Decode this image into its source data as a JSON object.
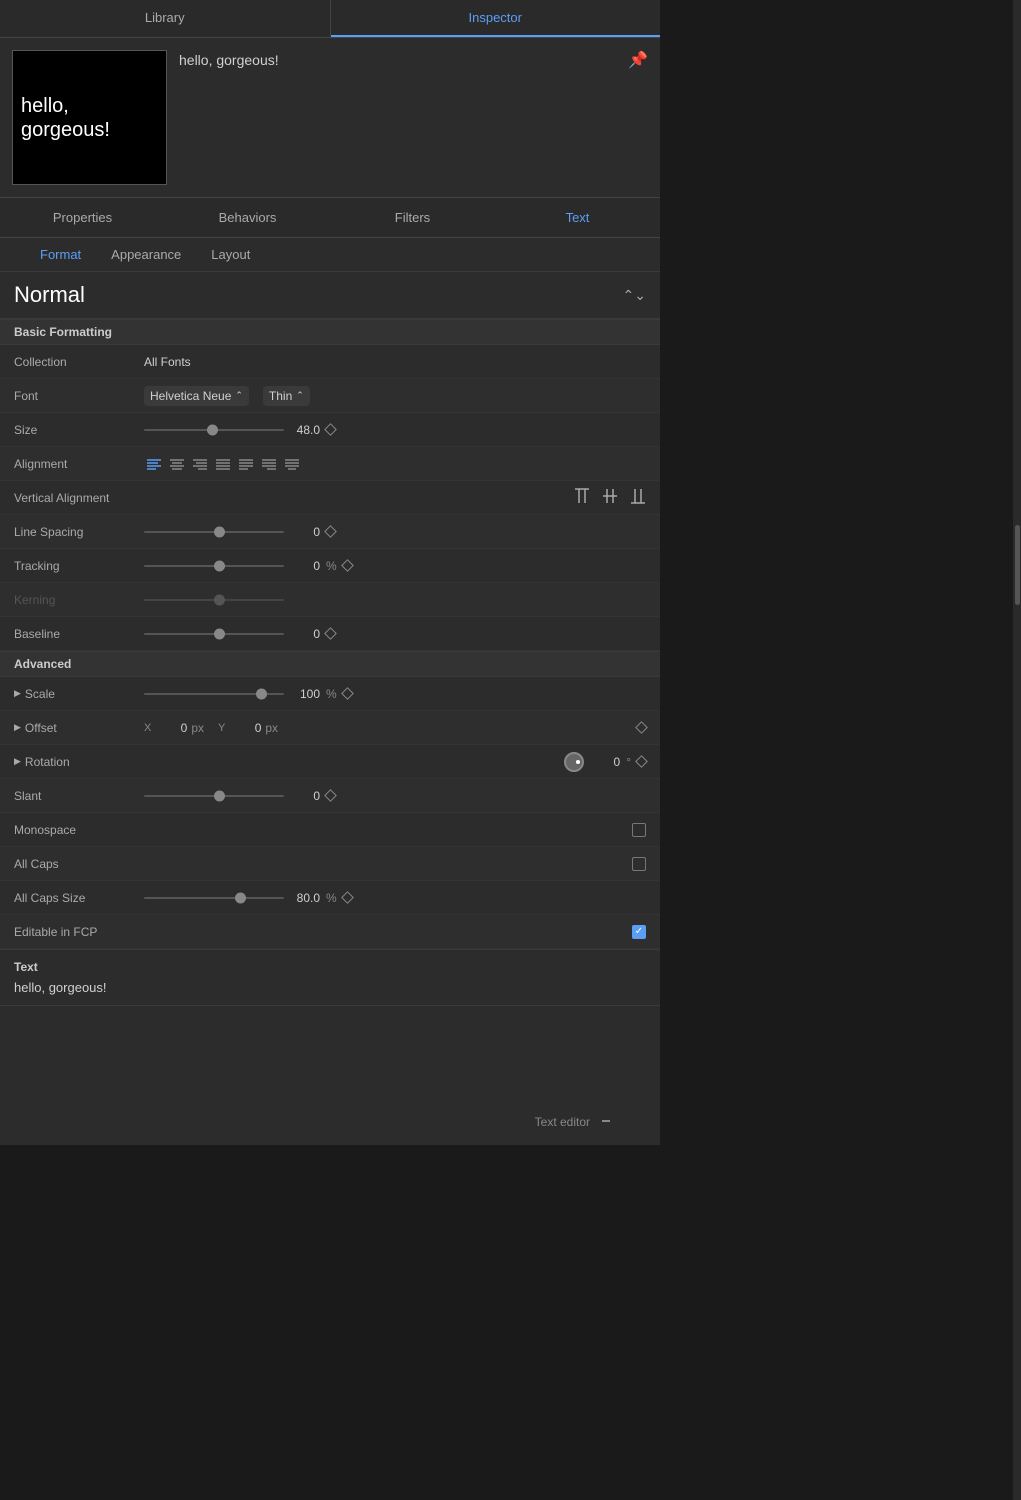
{
  "topTabs": [
    {
      "label": "Library",
      "active": false
    },
    {
      "label": "Inspector",
      "active": true
    }
  ],
  "preview": {
    "title": "hello, gorgeous!",
    "previewText": "hello, gorgeous!"
  },
  "inspectorTabs": [
    {
      "label": "Properties",
      "active": false
    },
    {
      "label": "Behaviors",
      "active": false
    },
    {
      "label": "Filters",
      "active": false
    },
    {
      "label": "Text",
      "active": true
    }
  ],
  "subTabs": [
    {
      "label": "Format",
      "active": true
    },
    {
      "label": "Appearance",
      "active": false
    },
    {
      "label": "Layout",
      "active": false
    }
  ],
  "styleSelector": {
    "name": "Normal"
  },
  "sections": {
    "basicFormatting": {
      "label": "Basic Formatting",
      "fields": {
        "collection": {
          "label": "Collection",
          "value": "All Fonts"
        },
        "font": {
          "label": "Font",
          "fontName": "Helvetica Neue",
          "fontWeight": "Thin"
        },
        "size": {
          "label": "Size",
          "value": "48.0",
          "sliderPos": "45%"
        },
        "alignment": {
          "label": "Alignment"
        },
        "verticalAlignment": {
          "label": "Vertical Alignment"
        },
        "lineSpacing": {
          "label": "Line Spacing",
          "value": "0",
          "sliderPos": "50%"
        },
        "tracking": {
          "label": "Tracking",
          "value": "0",
          "unit": "%",
          "sliderPos": "50%"
        },
        "kerning": {
          "label": "Kerning",
          "disabled": true,
          "sliderPos": "50%"
        },
        "baseline": {
          "label": "Baseline",
          "value": "0",
          "sliderPos": "50%"
        }
      }
    },
    "advanced": {
      "label": "Advanced",
      "fields": {
        "scale": {
          "label": "Scale",
          "value": "100",
          "unit": "%",
          "sliderPos": "80%"
        },
        "offset": {
          "label": "Offset",
          "xValue": "0",
          "yValue": "0",
          "unit": "px"
        },
        "rotation": {
          "label": "Rotation",
          "value": "0",
          "unit": "°"
        },
        "slant": {
          "label": "Slant",
          "value": "0",
          "sliderPos": "50%"
        },
        "monospace": {
          "label": "Monospace",
          "checked": false
        },
        "allCaps": {
          "label": "All Caps",
          "checked": false
        },
        "allCapsSize": {
          "label": "All Caps Size",
          "value": "80.0",
          "unit": "%",
          "sliderPos": "65%"
        },
        "editableInFCP": {
          "label": "Editable in FCP",
          "checked": true
        }
      }
    }
  },
  "textPreview": {
    "label": "Text",
    "content": "hello, gorgeous!"
  },
  "textEditorLabel": "Text editor",
  "alignmentButtons": [
    {
      "type": "left",
      "active": true,
      "symbol": "≡"
    },
    {
      "type": "center",
      "active": false,
      "symbol": "≡"
    },
    {
      "type": "right",
      "active": false,
      "symbol": "≡"
    },
    {
      "type": "justify",
      "active": false,
      "symbol": "≡"
    },
    {
      "type": "justify-left",
      "active": false,
      "symbol": "≡"
    },
    {
      "type": "justify-right",
      "active": false,
      "symbol": "≡"
    },
    {
      "type": "justify-all",
      "active": false,
      "symbol": "≡"
    }
  ],
  "vertAlignButtons": [
    {
      "type": "top",
      "symbol": "⊤"
    },
    {
      "type": "middle",
      "symbol": "⊥"
    },
    {
      "type": "bottom",
      "symbol": "⊥"
    }
  ]
}
